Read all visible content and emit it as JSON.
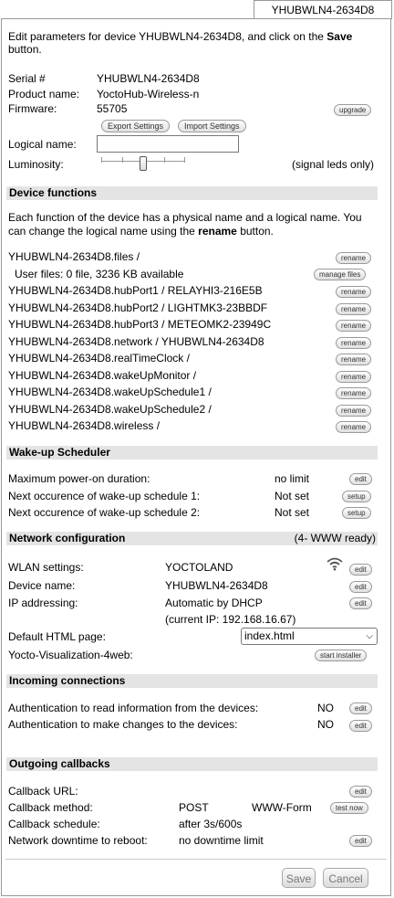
{
  "tab_title": "YHUBWLN4-2634D8",
  "intro": {
    "prefix": "Edit parameters for device YHUBWLN4-2634D8, and click on the ",
    "save_word": "Save",
    "suffix": "button."
  },
  "device": {
    "serial_label": "Serial #",
    "serial": "YHUBWLN4-2634D8",
    "product_label": "Product name:",
    "product": "YoctoHub-Wireless-n",
    "firmware_label": "Firmware:",
    "firmware": "55705",
    "upgrade": "upgrade",
    "export": "Export Settings",
    "import": "Import Settings",
    "logical_label": "Logical name:",
    "logical_value": "",
    "luminosity_label": "Luminosity:",
    "luminosity_note": "(signal leds only)",
    "luminosity_level": 0.5
  },
  "functions": {
    "title": "Device functions",
    "desc1": "Each function of the device has a physical name and a logical name. You",
    "desc2_prefix": "can change the logical name using the ",
    "desc2_bold": "rename",
    "desc2_suffix": " button.",
    "rename_label": "rename",
    "userfiles": "User files: 0 file, 3236 KB available",
    "manage": "manage files",
    "items": [
      "YHUBWLN4-2634D8.files /",
      "YHUBWLN4-2634D8.hubPort1 / RELAYHI3-216E5B",
      "YHUBWLN4-2634D8.hubPort2 / LIGHTMK3-23BBDF",
      "YHUBWLN4-2634D8.hubPort3 / METEOMK2-23949C",
      "YHUBWLN4-2634D8.network / YHUBWLN4-2634D8",
      "YHUBWLN4-2634D8.realTimeClock /",
      "YHUBWLN4-2634D8.wakeUpMonitor /",
      "YHUBWLN4-2634D8.wakeUpSchedule1 /",
      "YHUBWLN4-2634D8.wakeUpSchedule2 /",
      "YHUBWLN4-2634D8.wireless /"
    ]
  },
  "wakeup": {
    "title": "Wake-up Scheduler",
    "max_label": "Maximum power-on duration:",
    "max_value": "no limit",
    "edit": "edit",
    "s1_label": "Next occurence of wake-up schedule 1:",
    "s1_value": "Not set",
    "s2_label": "Next occurence of wake-up schedule 2:",
    "s2_value": "Not set",
    "setup": "setup"
  },
  "network": {
    "title": "Network configuration",
    "status": "(4- WWW ready)",
    "wlan_label": "WLAN settings:",
    "wlan_value": "YOCTOLAND",
    "devname_label": "Device name:",
    "devname_value": "YHUBWLN4-2634D8",
    "ip_label": "IP addressing:",
    "ip_value": "Automatic by DHCP",
    "current_ip": "(current IP: 192.168.16.67)",
    "html_label": "Default HTML page:",
    "html_value": "index.html",
    "viz_label": "Yocto-Visualization-4web:",
    "viz_button": "start installer",
    "edit": "edit"
  },
  "incoming": {
    "title": "Incoming connections",
    "read_label": "Authentication to read information from the devices:",
    "read_value": "NO",
    "change_label": "Authentication to make changes to the devices:",
    "change_value": "NO",
    "edit": "edit"
  },
  "outgoing": {
    "title": "Outgoing callbacks",
    "url_label": "Callback URL:",
    "method_label": "Callback method:",
    "method_value": "POST",
    "method_format": "WWW-Form",
    "test": "test now",
    "schedule_label": "Callback schedule:",
    "schedule_value": "after 3s/600s",
    "downtime_label": "Network downtime to reboot:",
    "downtime_value": "no downtime limit",
    "edit": "edit"
  },
  "footer": {
    "save": "Save",
    "cancel": "Cancel"
  }
}
